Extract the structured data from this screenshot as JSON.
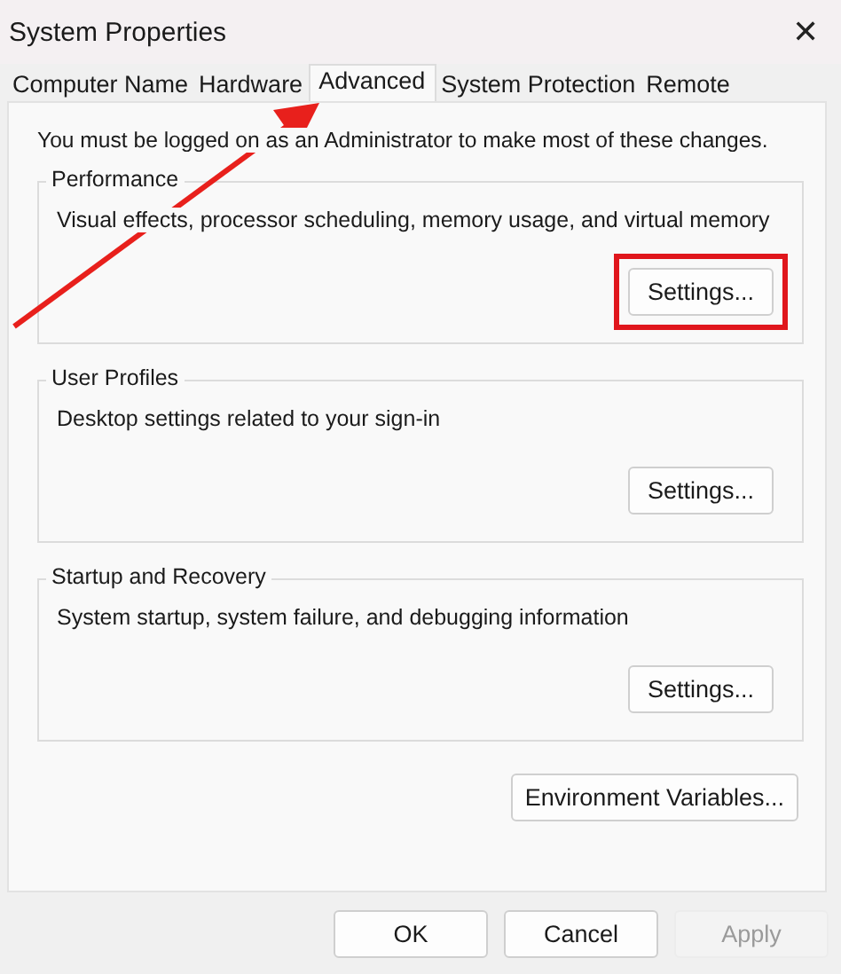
{
  "window": {
    "title": "System Properties",
    "close": "✕"
  },
  "tabs": [
    {
      "label": "Computer Name",
      "selected": false
    },
    {
      "label": "Hardware",
      "selected": false
    },
    {
      "label": "Advanced",
      "selected": true
    },
    {
      "label": "System Protection",
      "selected": false
    },
    {
      "label": "Remote",
      "selected": false
    }
  ],
  "notice": "You must be logged on as an Administrator to make most of these changes.",
  "groups": [
    {
      "title": "Performance",
      "description": "Visual effects, processor scheduling, memory usage, and virtual memory",
      "button": "Settings...",
      "highlighted": true
    },
    {
      "title": "User Profiles",
      "description": "Desktop settings related to your sign-in",
      "button": "Settings...",
      "highlighted": false
    },
    {
      "title": "Startup and Recovery",
      "description": "System startup, system failure, and debugging information",
      "button": "Settings...",
      "highlighted": false
    }
  ],
  "environment_button": "Environment Variables...",
  "buttons": [
    {
      "label": "OK",
      "disabled": false
    },
    {
      "label": "Cancel",
      "disabled": false
    },
    {
      "label": "Apply",
      "disabled": true
    }
  ]
}
